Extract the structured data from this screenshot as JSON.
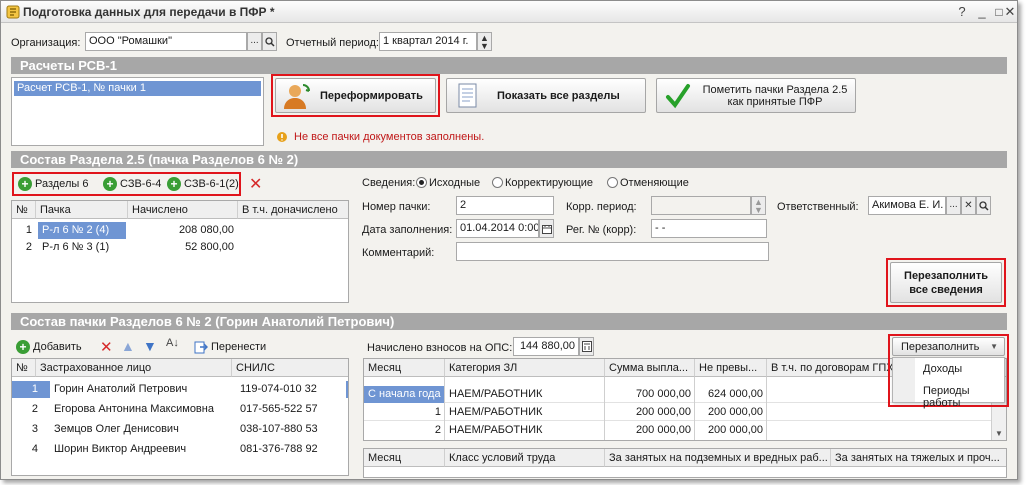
{
  "window": {
    "title": "Подготовка данных для передачи в ПФР *"
  },
  "org": {
    "label": "Организация:",
    "value": "ООО \"Ромашки\"",
    "period_label": "Отчетный период:",
    "period_value": "1 квартал 2014 г."
  },
  "rsv": {
    "section_title": "Расчеты РСВ-1",
    "list_item": "Расчет РСВ-1, № пачки 1",
    "reform_button": "Переформировать",
    "show_all_button": "Показать все разделы",
    "mark_button_line1": "Пометить пачки Раздела 2.5",
    "mark_button_line2": "как принятые ПФР",
    "warning": "Не все пачки документов заполнены."
  },
  "section25": {
    "title": "Состав Раздела 2.5    (пачка Разделов 6 № 2)",
    "tab_r6": "Разделы 6",
    "tab_szv64": "СЗВ-6-4",
    "tab_szv61": "СЗВ-6-1(2)",
    "grid": {
      "columns": [
        "№",
        "Пачка",
        "Начислено",
        "В т.ч. доначислено"
      ],
      "rows": [
        {
          "n": "1",
          "pack": "Р-л 6 № 2 (4)",
          "accrued": "208 080,00"
        },
        {
          "n": "2",
          "pack": "Р-л 6 № 3 (1)",
          "accrued": "52 800,00"
        }
      ]
    },
    "info": {
      "label": "Сведения:",
      "opt1": "Исходные",
      "opt2": "Корректирующие",
      "opt3": "Отменяющие",
      "num_label": "Номер пачки:",
      "num_value": "2",
      "corr_label": "Корр. период:",
      "resp_label": "Ответственный:",
      "resp_value": "Акимова Е. И.",
      "date_label": "Дата заполнения:",
      "date_value": "01.04.2014  0:00",
      "reg_label": "Рег. № (корр):",
      "reg_value": "-  -",
      "comment_label": "Комментарий:"
    },
    "refill_all_line1": "Перезаполнить",
    "refill_all_line2": "все сведения"
  },
  "pack6": {
    "title": "Состав пачки Разделов 6 № 2      (Горин Анатолий Петрович)",
    "toolbar": {
      "add": "Добавить",
      "move": "Перенести"
    },
    "grid": {
      "columns": [
        "№",
        "Застрахованное лицо",
        "СНИЛС"
      ],
      "rows": [
        {
          "n": "1",
          "name": "Горин Анатолий Петрович",
          "snils": "119-074-010 32"
        },
        {
          "n": "2",
          "name": "Егорова Антонина Максимовна",
          "snils": "017-565-522 57"
        },
        {
          "n": "3",
          "name": "Земцов Олег Денисович",
          "snils": "038-107-880 53"
        },
        {
          "n": "4",
          "name": "Шорин Виктор Андреевич",
          "snils": "081-376-788 92"
        }
      ]
    },
    "ops_label": "Начислено взносов на ОПС:",
    "ops_value": "144 880,00",
    "refill_button": "Перезаполнить",
    "menu": [
      "Доходы",
      "Периоды работы"
    ],
    "income_grid": {
      "columns": [
        "Месяц",
        "Категория ЗЛ",
        "Сумма выпла...",
        "Не превы...",
        "В т.ч. по договорам ГПХ"
      ],
      "rows": [
        {
          "month": "С начала года",
          "cat": "НАЕМ/РАБОТНИК",
          "sum": "700 000,00",
          "limit": "624 000,00"
        },
        {
          "month": "1",
          "cat": "НАЕМ/РАБОТНИК",
          "sum": "200 000,00",
          "limit": "200 000,00"
        },
        {
          "month": "2",
          "cat": "НАЕМ/РАБОТНИК",
          "sum": "200 000,00",
          "limit": "200 000,00"
        }
      ]
    },
    "work_grid": {
      "columns": [
        "Месяц",
        "Класс условий труда",
        "За занятых на подземных и вредных раб...",
        "За занятых на тяжелых и проч..."
      ]
    }
  }
}
